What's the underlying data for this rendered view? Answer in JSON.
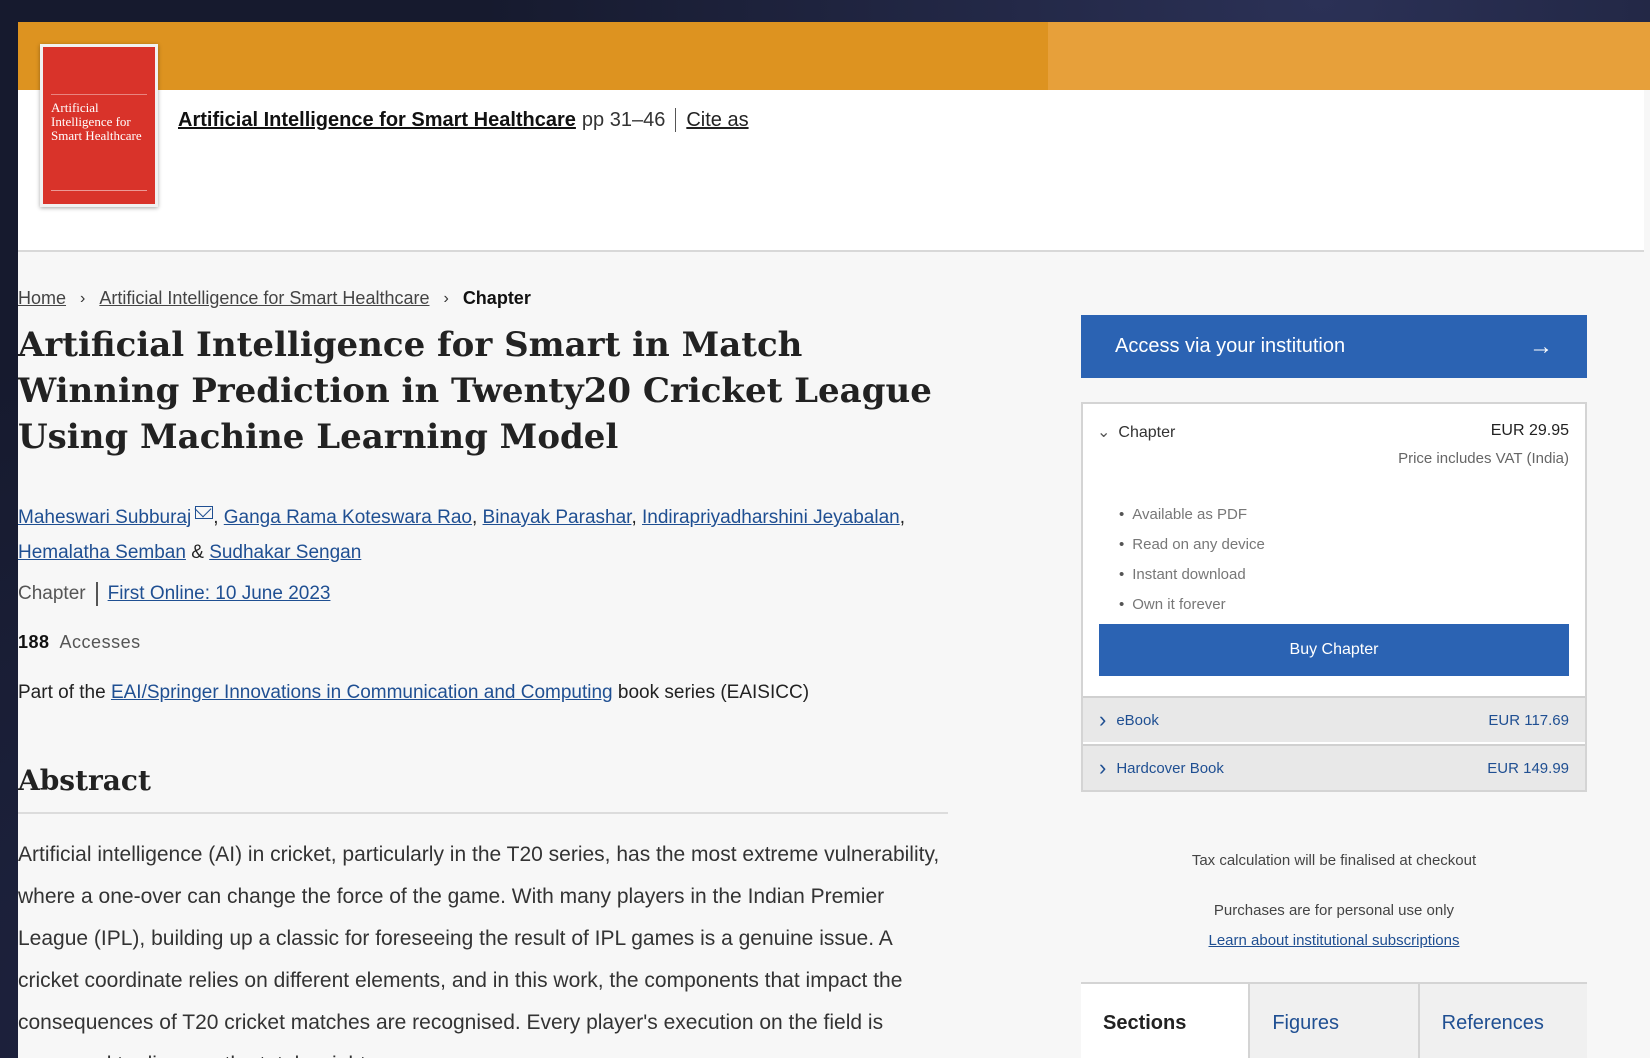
{
  "header": {
    "cover_title": "Artificial Intelligence for Smart Healthcare",
    "book_link": "Artificial Intelligence for Smart Healthcare",
    "pages": "pp 31–46",
    "cite": "Cite as"
  },
  "breadcrumb": {
    "home": "Home",
    "book": "Artificial Intelligence for Smart Healthcare",
    "current": "Chapter"
  },
  "article": {
    "title": "Artificial Intelligence for Smart in Match Winning Prediction in Twenty20 Cricket League Using Machine Learning Model",
    "authors": [
      "Maheswari Subburaj",
      "Ganga Rama Koteswara Rao",
      "Binayak Parashar",
      "Indirapriyadharshini Jeyabalan",
      "Hemalatha Semban",
      "Sudhakar Sengan"
    ],
    "amp": "&",
    "type": "Chapter",
    "first_online": "First Online: 10 June 2023",
    "accesses_count": "188",
    "accesses_label": "Accesses",
    "series_prefix": "Part of the",
    "series_link": "EAI/Springer Innovations in Communication and Computing",
    "series_suffix": "book series (EAISICC)",
    "abstract_heading": "Abstract",
    "abstract": "Artificial intelligence (AI) in cricket, particularly in the T20 series, has the most extreme vulnerability, where a one-over can change the force of the game. With many players in the Indian Premier League (IPL), building up a classic for foreseeing the result of IPL games is a genuine issue. A cricket coordinate relies on different elements, and in this work, the components that impact the consequences of T20 cricket matches are recognised. Every player's execution on the field is measured to discover the total weight"
  },
  "sidebar": {
    "access_button": "Access via your institution",
    "access_arrow": "→",
    "chapter_label": "Chapter",
    "chapter_price": "EUR  29.95",
    "vat_note": "Price includes VAT (India)",
    "features": [
      "Available as PDF",
      "Read on any device",
      "Instant download",
      "Own it forever"
    ],
    "buy_button": "Buy Chapter",
    "options": [
      {
        "label": "eBook",
        "price": "EUR  117.69"
      },
      {
        "label": "Hardcover Book",
        "price": "EUR  149.99"
      }
    ],
    "tax_note": "Tax calculation will be finalised at checkout",
    "personal_note": "Purchases are for personal use only",
    "institutional_link": "Learn about institutional subscriptions",
    "tabs": [
      "Sections",
      "Figures",
      "References"
    ]
  },
  "colors": {
    "orange_bar": "#dd9320",
    "link_blue": "#1f4f92",
    "button_blue": "#2b63b3",
    "cover_red": "#d9332a"
  }
}
